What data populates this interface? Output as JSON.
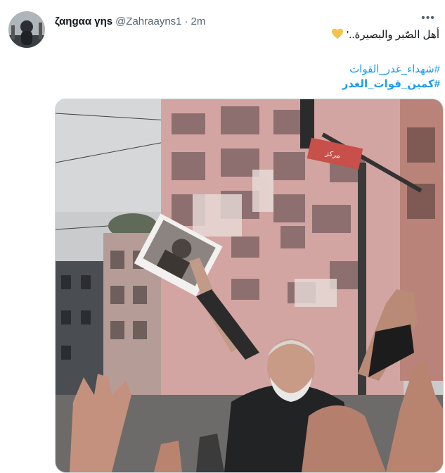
{
  "author": {
    "display_name": "ζαηgαα γηs",
    "handle": "@Zahraayns1",
    "separator": "·",
    "time": "2m"
  },
  "tweet": {
    "text": "أهل الصّبر والبصيرة..'",
    "emoji": "yellow-heart-icon",
    "hashtags": [
      "#شهداء_غدر_القوات",
      "#كمين_قوات_الغدر"
    ]
  },
  "media": {
    "description_icon": "protest-photo",
    "sign_text": "مركز"
  },
  "colors": {
    "link": "#1d9bf0",
    "secondary_text": "#536471",
    "border": "#cfd9de",
    "heart": "#f5c24b"
  }
}
